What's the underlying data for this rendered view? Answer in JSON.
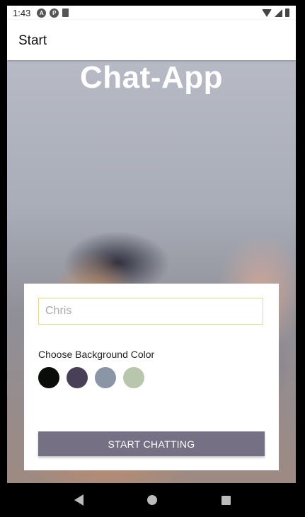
{
  "status_bar": {
    "time": "1:43",
    "left_icons": [
      "a-icon",
      "p-icon",
      "sd-card-icon"
    ],
    "right_icons": [
      "wifi-icon",
      "signal-icon",
      "battery-icon"
    ]
  },
  "app_bar": {
    "title": "Start"
  },
  "hero": {
    "title": "Chat-App"
  },
  "form": {
    "name_input": {
      "value": "",
      "placeholder": "Chris"
    },
    "color_label": "Choose Background Color",
    "colors": [
      "#090C08",
      "#474056",
      "#8A95A5",
      "#B9C6AE"
    ],
    "start_button_label": "START CHATTING",
    "start_button_color": "#757083"
  },
  "nav_bar": {
    "buttons": [
      "back-icon",
      "home-icon",
      "recents-icon"
    ]
  }
}
